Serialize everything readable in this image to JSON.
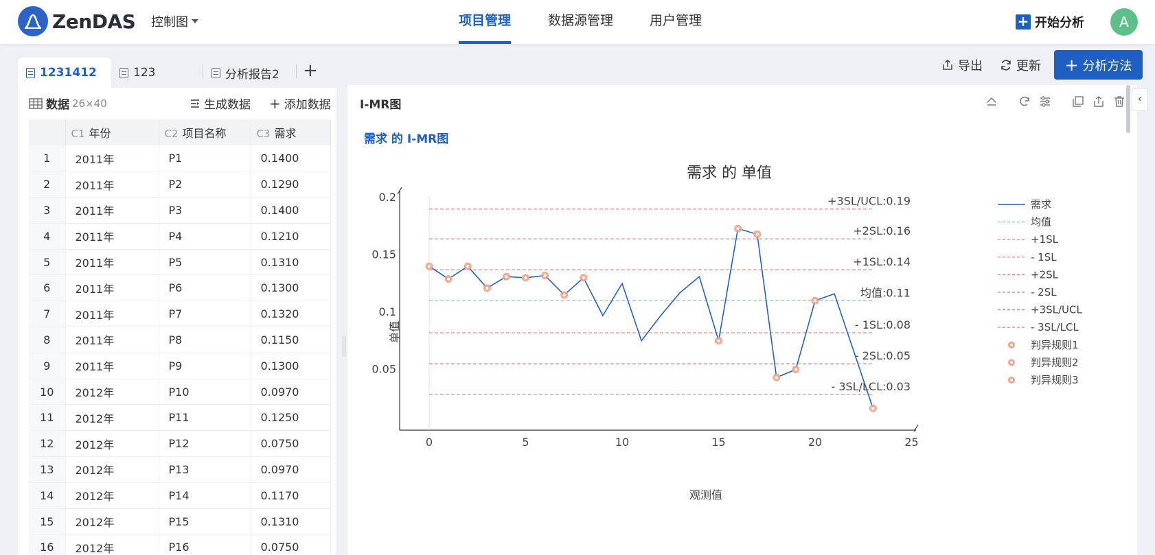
{
  "app": {
    "brand": "ZenDAS",
    "view_selector": "控制图"
  },
  "nav": {
    "items": [
      "项目管理",
      "数据源管理",
      "用户管理"
    ],
    "active": "项目管理"
  },
  "header": {
    "start_label": "开始分析",
    "avatar_letter": "A"
  },
  "tabs": [
    {
      "label": "1231412",
      "active": true
    },
    {
      "label": "123",
      "active": false
    },
    {
      "label": "分析报告2",
      "active": false
    }
  ],
  "toolbar": {
    "export_label": "导出",
    "refresh_label": "更新",
    "method_label": "分析方法"
  },
  "data_panel": {
    "title": "数据",
    "dims": "26×40",
    "generate_label": "生成数据",
    "add_label": "添加数据",
    "columns": [
      {
        "id": "C1",
        "name": "年份"
      },
      {
        "id": "C2",
        "name": "项目名称"
      },
      {
        "id": "C3",
        "name": "需求"
      }
    ],
    "rows": [
      [
        "1",
        "2011年",
        "P1",
        "0.1400"
      ],
      [
        "2",
        "2011年",
        "P2",
        "0.1290"
      ],
      [
        "3",
        "2011年",
        "P3",
        "0.1400"
      ],
      [
        "4",
        "2011年",
        "P4",
        "0.1210"
      ],
      [
        "5",
        "2011年",
        "P5",
        "0.1310"
      ],
      [
        "6",
        "2011年",
        "P6",
        "0.1300"
      ],
      [
        "7",
        "2011年",
        "P7",
        "0.1320"
      ],
      [
        "8",
        "2011年",
        "P8",
        "0.1150"
      ],
      [
        "9",
        "2011年",
        "P9",
        "0.1300"
      ],
      [
        "10",
        "2012年",
        "P10",
        "0.0970"
      ],
      [
        "11",
        "2012年",
        "P11",
        "0.1250"
      ],
      [
        "12",
        "2012年",
        "P12",
        "0.0750"
      ],
      [
        "13",
        "2012年",
        "P13",
        "0.0970"
      ],
      [
        "14",
        "2012年",
        "P14",
        "0.1170"
      ],
      [
        "15",
        "2012年",
        "P15",
        "0.1310"
      ],
      [
        "16",
        "2012年",
        "P16",
        "0.0750"
      ]
    ]
  },
  "result_panel": {
    "title": "I-MR图",
    "chart_link": "需求 的 I-MR图"
  },
  "colors": {
    "accent": "#1e5fc4",
    "series": "#1f5fd6",
    "limit": "#e07b6e",
    "mean": "#7fc3b5",
    "violation": "#f0a58a"
  },
  "chart_data": {
    "type": "line",
    "title": "需求 的 单值",
    "xlabel": "观测值",
    "ylabel": "单值",
    "xlim": [
      0,
      25
    ],
    "xticks": [
      "0",
      "5",
      "10",
      "15",
      "20",
      "25"
    ],
    "ylim": [
      0,
      0.2
    ],
    "yticks": [
      "0.05",
      "0.1",
      "0.15",
      "0.2"
    ],
    "series": [
      {
        "name": "需求",
        "x": [
          0,
          1,
          2,
          3,
          4,
          5,
          6,
          7,
          8,
          9,
          10,
          11,
          12,
          13,
          14,
          15,
          16,
          17,
          18,
          19,
          20,
          21,
          22,
          23
        ],
        "values": [
          0.14,
          0.129,
          0.14,
          0.121,
          0.131,
          0.13,
          0.132,
          0.115,
          0.13,
          0.097,
          0.125,
          0.075,
          0.097,
          0.117,
          0.131,
          0.075,
          0.173,
          0.168,
          0.043,
          0.05,
          0.11,
          0.116,
          0.066,
          0.016
        ]
      }
    ],
    "violations_x": [
      0,
      1,
      2,
      3,
      4,
      5,
      6,
      7,
      8,
      15,
      16,
      17,
      18,
      19,
      20,
      23
    ],
    "reference_lines": [
      {
        "label": "+3SL/UCL:0.19",
        "value": 0.19,
        "style": "limit"
      },
      {
        "label": "+2SL:0.16",
        "value": 0.164,
        "style": "limit"
      },
      {
        "label": "+1SL:0.14",
        "value": 0.137,
        "style": "limit"
      },
      {
        "label": "均值:0.11",
        "value": 0.11,
        "style": "mean"
      },
      {
        "label": "- 1SL:0.08",
        "value": 0.082,
        "style": "limit"
      },
      {
        "label": "- 2SL:0.05",
        "value": 0.055,
        "style": "limit"
      },
      {
        "label": "- 3SL/LCL:0.03",
        "value": 0.028,
        "style": "limit"
      }
    ],
    "legend": [
      {
        "label": "需求",
        "kind": "line"
      },
      {
        "label": "均值",
        "kind": "mean"
      },
      {
        "label": "+1SL",
        "kind": "limit"
      },
      {
        "label": "- 1SL",
        "kind": "limit"
      },
      {
        "label": "+2SL",
        "kind": "limit"
      },
      {
        "label": "- 2SL",
        "kind": "limit"
      },
      {
        "label": "+3SL/UCL",
        "kind": "limit"
      },
      {
        "label": "- 3SL/LCL",
        "kind": "limit"
      },
      {
        "label": "判异规则1",
        "kind": "marker"
      },
      {
        "label": "判异规则2",
        "kind": "marker"
      },
      {
        "label": "判异规则3",
        "kind": "marker"
      }
    ],
    "legend_position": "right",
    "grid": false
  }
}
